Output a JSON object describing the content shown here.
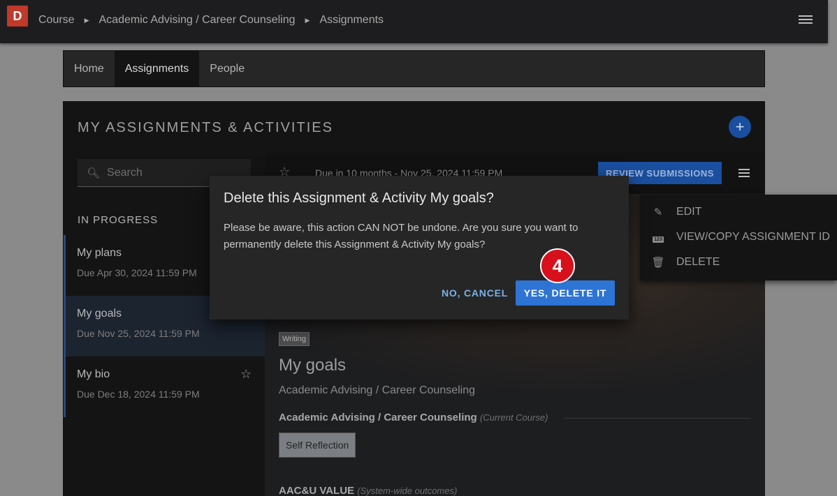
{
  "topbar": {
    "logo": "D",
    "breadcrumbs": [
      "Course",
      "Academic Advising / Career Counseling",
      "Assignments"
    ]
  },
  "tabs": [
    {
      "label": "Home",
      "active": false
    },
    {
      "label": "Assignments",
      "active": true
    },
    {
      "label": "People",
      "active": false
    }
  ],
  "panel": {
    "title": "MY ASSIGNMENTS & ACTIVITIES",
    "add_label": "+"
  },
  "sidebar": {
    "search_placeholder": "Search",
    "section": "IN PROGRESS",
    "items": [
      {
        "title": "My plans",
        "due": "Due Apr 30, 2024 11:59 PM"
      },
      {
        "title": "My goals",
        "due": "Due Nov 25, 2024 11:59 PM"
      },
      {
        "title": "My bio",
        "due": "Due Dec 18, 2024 11:59 PM"
      }
    ]
  },
  "content": {
    "due": "Due in 10 months - Nov 25, 2024 11:59 PM",
    "review_label": "REVIEW SUBMISSIONS",
    "tag": "Writing",
    "title": "My goals",
    "course": "Academic Advising / Career Counseling",
    "current_course": "Academic Advising / Career Counseling",
    "current_course_note": "(Current Course)",
    "outcome_chip": "Self Reflection",
    "aacu": "AAC&U VALUE",
    "aacu_note": "(System-wide outcomes)"
  },
  "context_menu": {
    "items": [
      {
        "label": "EDIT",
        "icon": "pencil-icon"
      },
      {
        "label": "VIEW/COPY ASSIGNMENT ID",
        "icon": "id-number-icon"
      },
      {
        "label": "DELETE",
        "icon": "trash-icon"
      }
    ]
  },
  "dialog": {
    "title": "Delete this Assignment & Activity My goals?",
    "body": "Please be aware, this action CAN NOT be undone. Are you sure you want to permanently delete this Assignment & Activity My goals?",
    "cancel_label": "NO, CANCEL",
    "confirm_label": "YES, DELETE IT"
  },
  "step_badge": "4",
  "colors": {
    "accent": "#2d74d4",
    "badge": "#d7101c",
    "logo": "#c0392b"
  }
}
